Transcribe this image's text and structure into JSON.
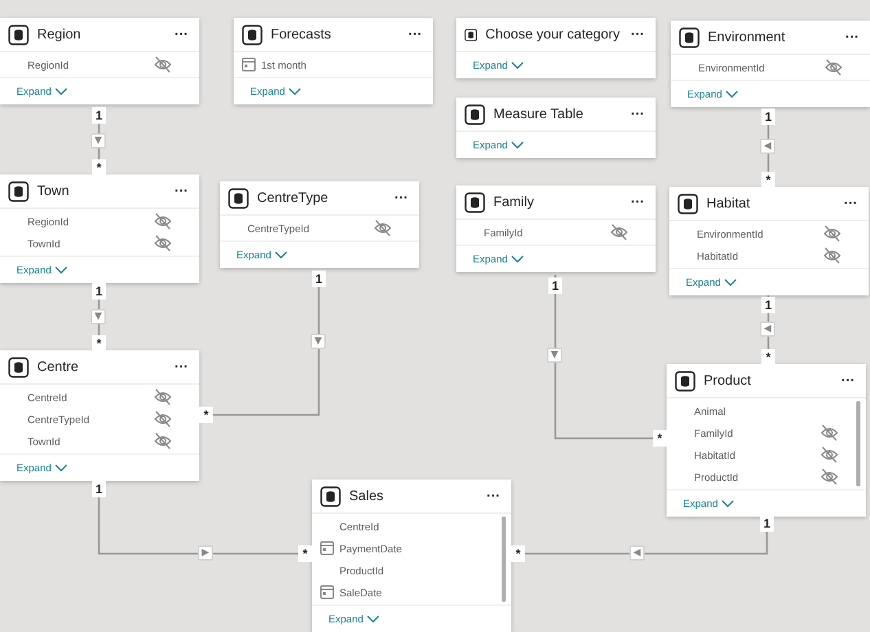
{
  "tables": [
    {
      "name": "Region",
      "more": "···",
      "fields": [
        {
          "name": "RegionId",
          "kind": "column",
          "hidden": true
        }
      ],
      "expand": "Expand"
    },
    {
      "name": "Forecasts",
      "more": "···",
      "fields": [
        {
          "name": "1st month",
          "kind": "date",
          "hidden": false
        }
      ],
      "expand": "Expand"
    },
    {
      "name": "Choose your category",
      "more": "···",
      "expand": "Expand"
    },
    {
      "name": "Environment",
      "more": "···",
      "fields": [
        {
          "name": "EnvironmentId",
          "kind": "column",
          "hidden": true
        }
      ],
      "expand": "Expand"
    },
    {
      "name": "Measure Table",
      "more": "···",
      "expand": "Expand"
    },
    {
      "name": "Town",
      "more": "···",
      "fields": [
        {
          "name": "RegionId",
          "kind": "column",
          "hidden": true
        },
        {
          "name": "TownId",
          "kind": "column",
          "hidden": true
        }
      ],
      "expand": "Expand"
    },
    {
      "name": "CentreType",
      "more": "···",
      "fields": [
        {
          "name": "CentreTypeId",
          "kind": "column",
          "hidden": true
        }
      ],
      "expand": "Expand"
    },
    {
      "name": "Family",
      "more": "···",
      "fields": [
        {
          "name": "FamilyId",
          "kind": "column",
          "hidden": true
        }
      ],
      "expand": "Expand"
    },
    {
      "name": "Habitat",
      "more": "···",
      "fields": [
        {
          "name": "EnvironmentId",
          "kind": "column",
          "hidden": true
        },
        {
          "name": "HabitatId",
          "kind": "column",
          "hidden": true
        }
      ],
      "expand": "Expand"
    },
    {
      "name": "Centre",
      "more": "···",
      "fields": [
        {
          "name": "CentreId",
          "kind": "column",
          "hidden": true
        },
        {
          "name": "CentreTypeId",
          "kind": "column",
          "hidden": true
        },
        {
          "name": "TownId",
          "kind": "column",
          "hidden": true
        }
      ],
      "expand": "Expand"
    },
    {
      "name": "Product",
      "more": "···",
      "fields": [
        {
          "name": "Animal",
          "kind": "column",
          "hidden": false
        },
        {
          "name": "FamilyId",
          "kind": "column",
          "hidden": true
        },
        {
          "name": "HabitatId",
          "kind": "column",
          "hidden": true
        },
        {
          "name": "ProductId",
          "kind": "column",
          "hidden": true
        }
      ],
      "expand": "Expand",
      "scrollbar": true
    },
    {
      "name": "Sales",
      "more": "···",
      "fields": [
        {
          "name": "CentreId",
          "kind": "column",
          "hidden": false
        },
        {
          "name": "PaymentDate",
          "kind": "date",
          "hidden": false
        },
        {
          "name": "ProductId",
          "kind": "column",
          "hidden": false
        },
        {
          "name": "SaleDate",
          "kind": "date",
          "hidden": false
        }
      ],
      "expand": "Expand",
      "scrollbar": true
    }
  ],
  "relationships": [
    {
      "one": "1",
      "many": "*",
      "arrow": "▼"
    },
    {
      "one": "1",
      "many": "*",
      "arrow": "◀"
    },
    {
      "one": "1",
      "many": "*",
      "arrow": "▼"
    },
    {
      "one": "1",
      "many": "*",
      "arrow": "▼"
    },
    {
      "one": "1",
      "many": "*",
      "arrow": "▼"
    },
    {
      "one": "1",
      "many": "*",
      "arrow": "◀"
    },
    {
      "one": "1",
      "many": "*",
      "arrow": "▶"
    },
    {
      "one": "1",
      "many": "*",
      "arrow": "◀"
    }
  ]
}
